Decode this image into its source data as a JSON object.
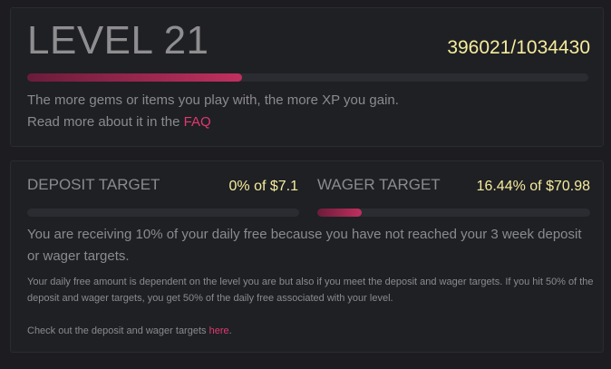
{
  "level": {
    "title": "LEVEL 21",
    "xp": "396021/1034430",
    "progress": 0.3828,
    "hint_line1": "The more gems or items you play with, the more XP you gain.",
    "hint_line2_prefix": "Read more about it in the ",
    "faq_link": "FAQ"
  },
  "targets": {
    "deposit": {
      "label": "DEPOSIT TARGET",
      "value": "0% of $7.1",
      "progress": 0
    },
    "wager": {
      "label": "WAGER TARGET",
      "value": "16.44% of $70.98",
      "progress": 0.1644
    },
    "status": "You are receiving 10% of your daily free because you have not reached your 3 week deposit or wager targets.",
    "info": "Your daily free amount is dependent on the level you are but also if you meet the deposit and wager targets. If you hit 50% of the deposit and wager targets, you get 50% of the daily free associated with your level.",
    "check_prefix": "Check out the deposit and wager targets ",
    "check_link": "here",
    "check_suffix": "."
  },
  "colors": {
    "accent": "#e0396f",
    "highlight": "#f6ec9d",
    "bar_start": "#6a1c3a",
    "bar_end": "#c0305e"
  }
}
